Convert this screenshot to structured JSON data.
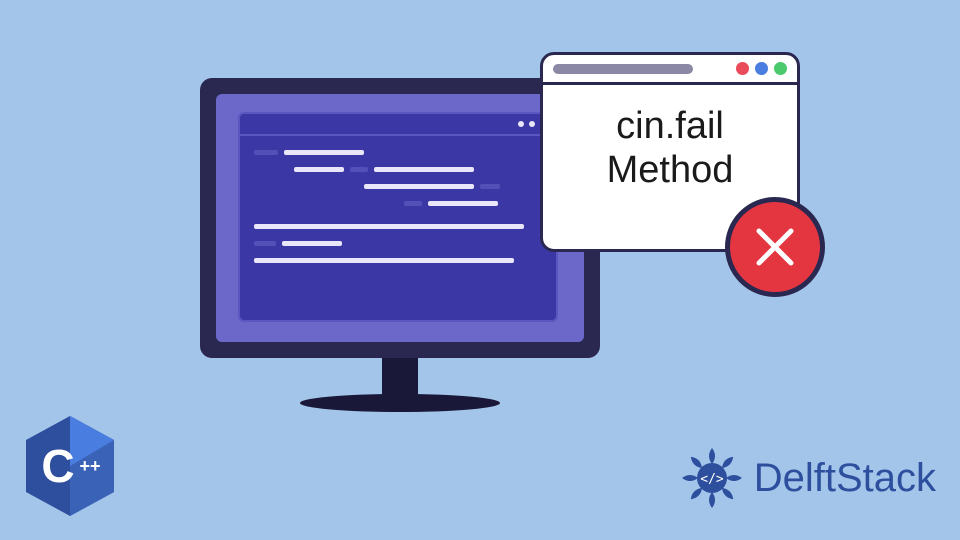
{
  "dialog": {
    "line1": "cin.fail",
    "line2": "Method"
  },
  "brand": {
    "name": "DelftStack"
  },
  "cpp": {
    "letter": "C",
    "plusplus": "++"
  }
}
